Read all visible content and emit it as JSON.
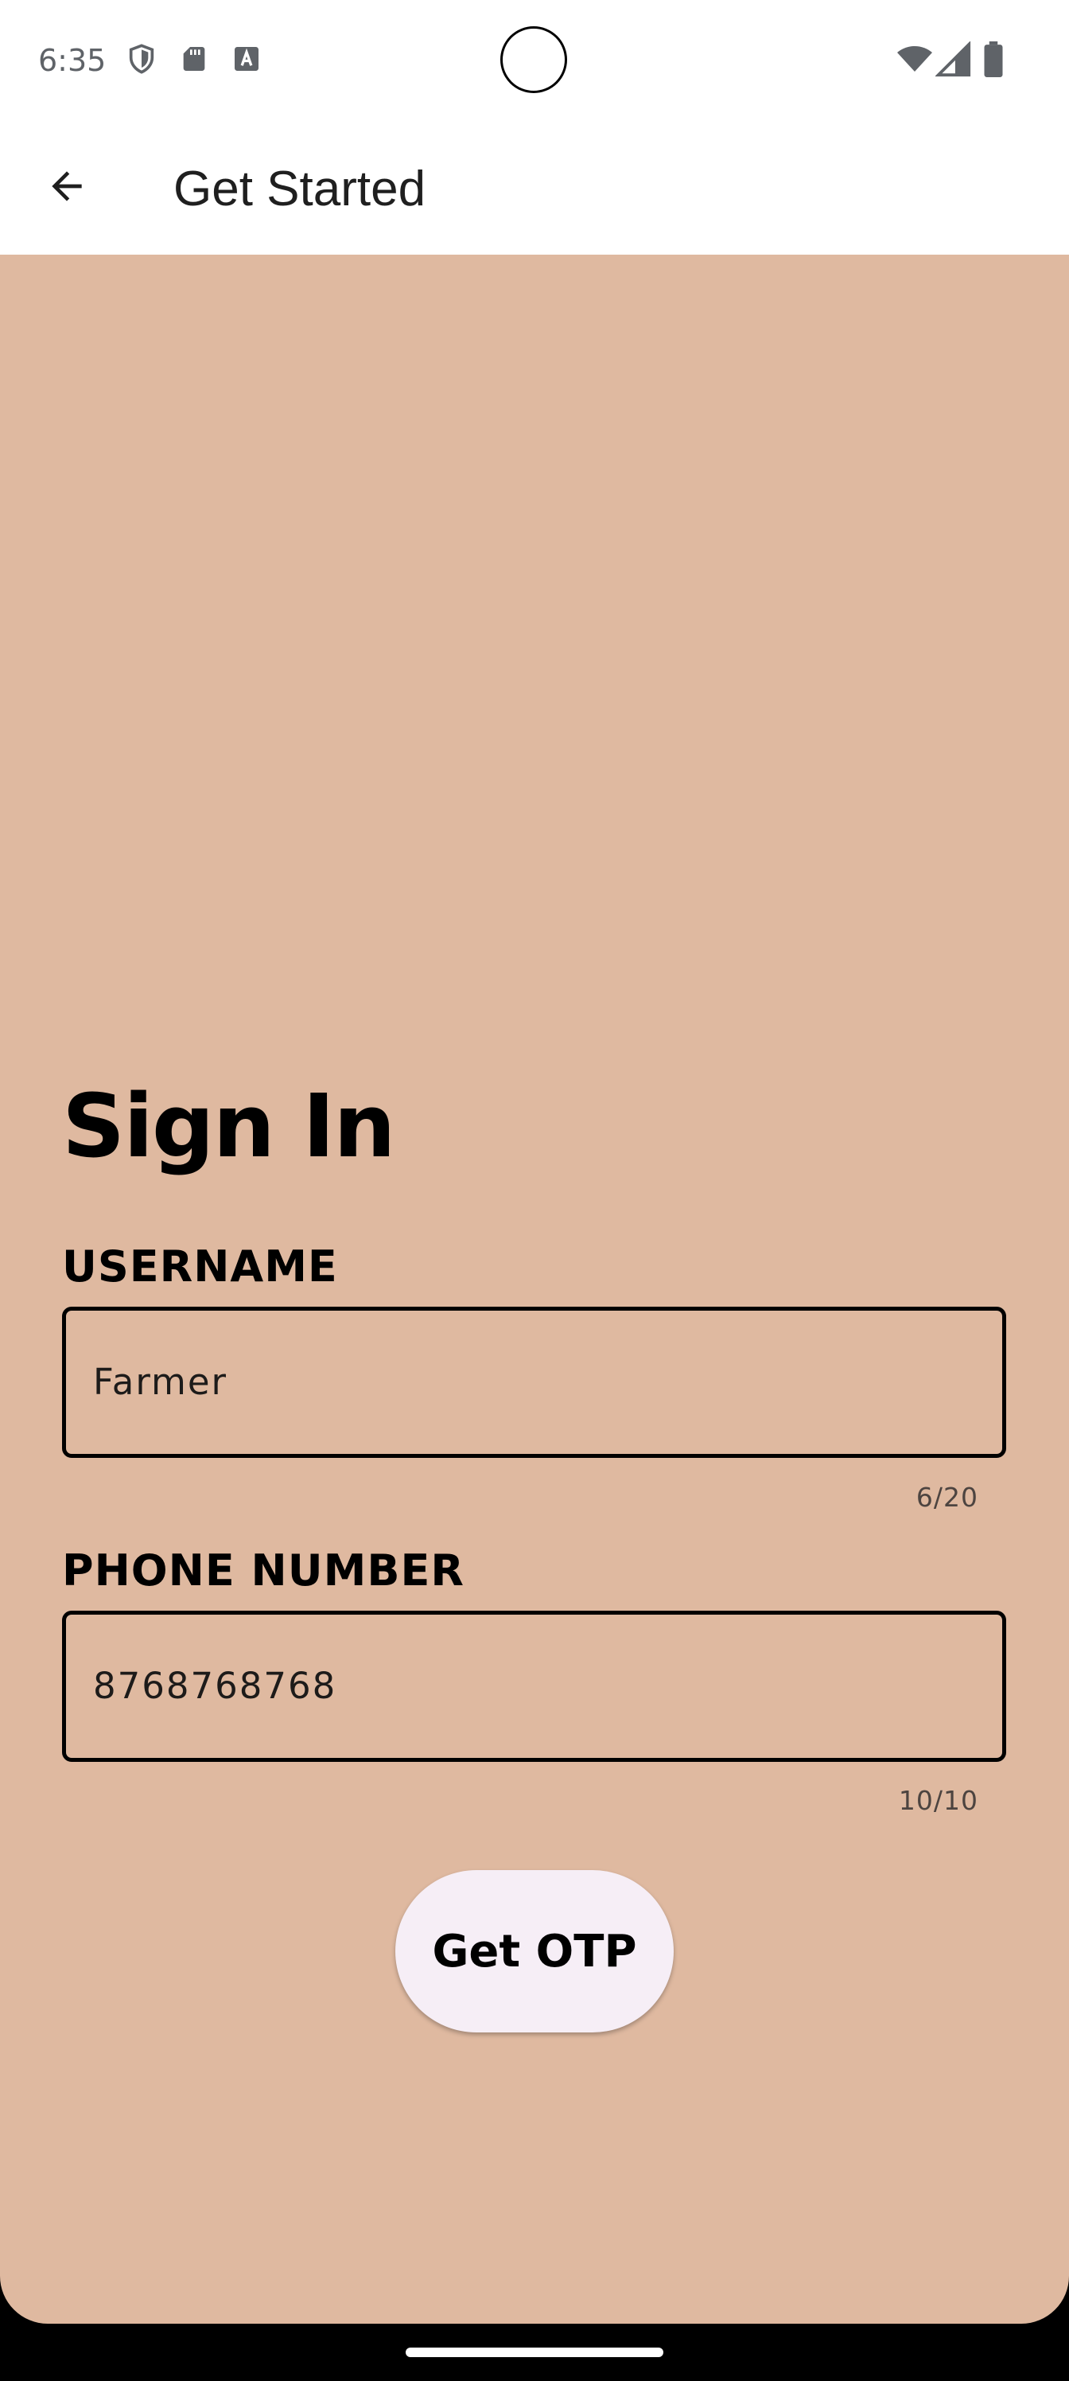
{
  "status_bar": {
    "time": "6:35",
    "icons": [
      "shield-icon",
      "sd-card-icon",
      "font-download-icon",
      "wifi-icon",
      "cellular-signal-icon",
      "battery-icon"
    ]
  },
  "app_bar": {
    "title": "Get Started",
    "back_icon": "arrow-back-icon"
  },
  "form": {
    "title": "Sign In",
    "username": {
      "label": "USERNAME",
      "value": "Farmer",
      "counter": "6/20"
    },
    "phone": {
      "label": "PHONE NUMBER",
      "value": "8768768768",
      "counter": "10/10"
    },
    "submit_label": "Get OTP"
  },
  "colors": {
    "background": "#dfb9a0",
    "button": "#f6eef6",
    "app_bar": "#ffffff"
  }
}
